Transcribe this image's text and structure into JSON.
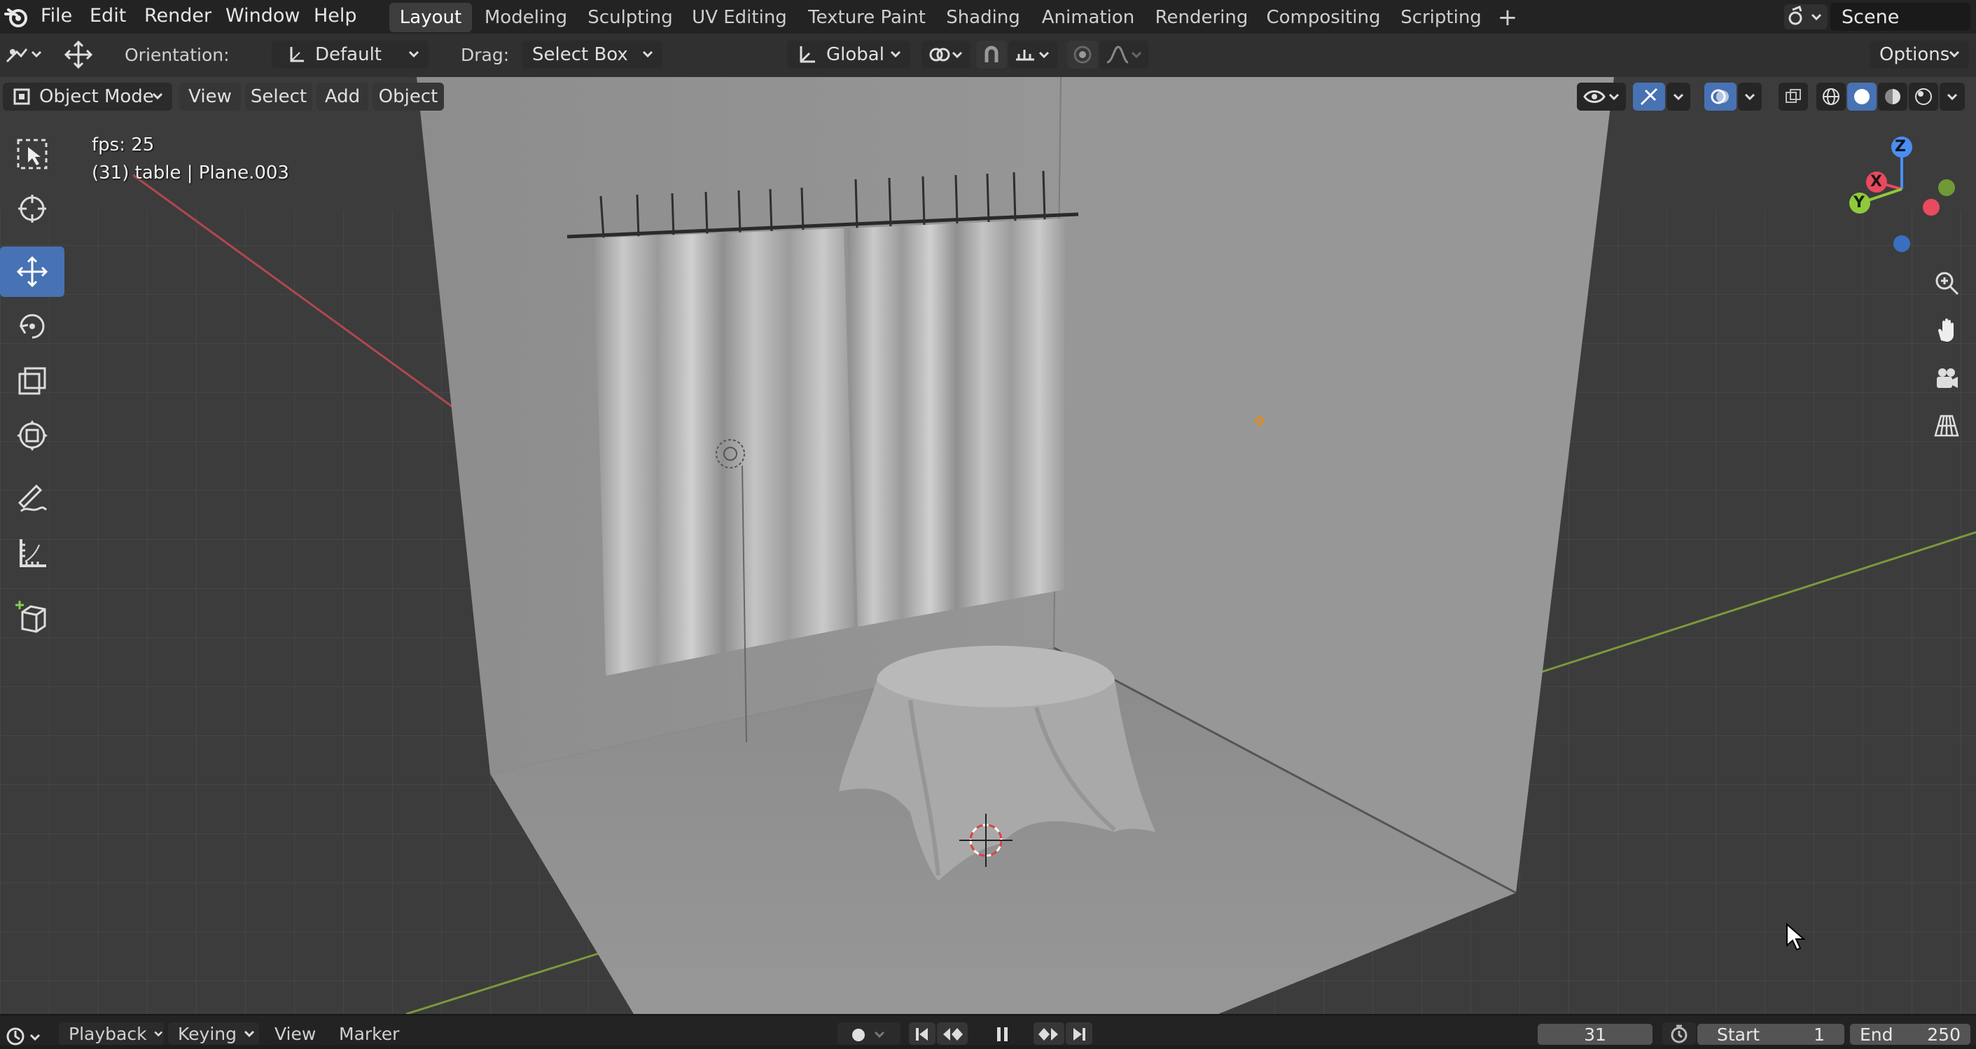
{
  "menu": {
    "items": [
      "File",
      "Edit",
      "Render",
      "Window",
      "Help"
    ]
  },
  "workspaces": {
    "tabs": [
      "Layout",
      "Modeling",
      "Sculpting",
      "UV Editing",
      "Texture Paint",
      "Shading",
      "Animation",
      "Rendering",
      "Compositing",
      "Scripting"
    ],
    "active": "Layout",
    "add_symbol": "+"
  },
  "scene": {
    "name": "Scene"
  },
  "tool_header": {
    "orientation_label": "Orientation:",
    "orientation_value": "Default",
    "drag_label": "Drag:",
    "drag_value": "Select Box",
    "transform_space": "Global",
    "options_label": "Options"
  },
  "viewport_header": {
    "mode": "Object Mode",
    "view": "View",
    "select": "Select",
    "add": "Add",
    "object": "Object"
  },
  "viewport": {
    "fps": "fps: 25",
    "active_object": "(31) table | Plane.003",
    "gizmo_axes": {
      "x": "X",
      "y": "Y",
      "z": "Z"
    }
  },
  "toolbar": {
    "tools": [
      "select-box",
      "cursor",
      "move",
      "rotate",
      "scale",
      "transform",
      "annotate",
      "measure",
      "add-cube"
    ],
    "active": "move"
  },
  "timeline": {
    "playback": "Playback",
    "keying": "Keying",
    "view": "View",
    "marker": "Marker",
    "current_frame": "31",
    "start_label": "Start",
    "start_value": "1",
    "end_label": "End",
    "end_value": "250"
  },
  "colors": {
    "accent": "#4772b3",
    "x_axis": "#e84a5f",
    "y_axis": "#8fc93a",
    "z_axis": "#4b8ef1",
    "header_bg": "#303030",
    "viewport_bg": "#3d3d3d"
  }
}
